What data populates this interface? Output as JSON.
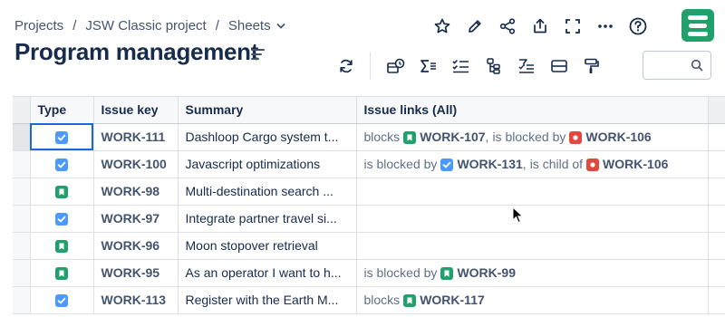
{
  "breadcrumb": {
    "items": [
      "Projects",
      "JSW Classic project",
      "Sheets"
    ]
  },
  "page": {
    "title": "Program management"
  },
  "top_actions": [
    "star-icon",
    "pencil-icon",
    "share-icon",
    "export-icon",
    "fullscreen-icon",
    "more-icon",
    "help-icon"
  ],
  "toolbar": {
    "tools": [
      "sync-icon",
      "issue-picker-icon",
      "sum-icon",
      "checklist-icon",
      "hierarchy-icon",
      "filter-list-icon",
      "row-height-icon",
      "paint-roller-icon"
    ]
  },
  "search": {
    "value": ""
  },
  "grid": {
    "columns": [
      "Type",
      "Issue key",
      "Summary",
      "Issue links (All)"
    ],
    "rows": [
      {
        "type": "task",
        "key": "WORK-111",
        "summary": "Dashloop Cargo system t...",
        "links": [
          {
            "rel": "blocks",
            "type": "story",
            "key": "WORK-107"
          },
          {
            "rel": "is blocked by",
            "type": "bug",
            "key": "WORK-106"
          }
        ]
      },
      {
        "type": "task",
        "key": "WORK-100",
        "summary": "Javascript optimizations",
        "links": [
          {
            "rel": "is blocked by",
            "type": "task",
            "key": "WORK-131"
          },
          {
            "rel": "is child of",
            "type": "bug",
            "key": "WORK-106"
          }
        ]
      },
      {
        "type": "story",
        "key": "WORK-98",
        "summary": "Multi-destination search ...",
        "links": []
      },
      {
        "type": "task",
        "key": "WORK-97",
        "summary": "Integrate partner travel si...",
        "links": []
      },
      {
        "type": "story",
        "key": "WORK-96",
        "summary": "Moon stopover retrieval",
        "links": []
      },
      {
        "type": "story",
        "key": "WORK-95",
        "summary": "As an operator I want to h...",
        "links": [
          {
            "rel": "is blocked by",
            "type": "story",
            "key": "WORK-99"
          }
        ]
      },
      {
        "type": "task",
        "key": "WORK-113",
        "summary": "Register with the Earth M...",
        "links": [
          {
            "rel": "blocks",
            "type": "story",
            "key": "WORK-117"
          }
        ]
      }
    ]
  },
  "colors": {
    "task": "#4c9aff",
    "story": "#22a06b",
    "bug": "#e2483d",
    "brand": "#22a06b",
    "selection": "#1868db"
  }
}
